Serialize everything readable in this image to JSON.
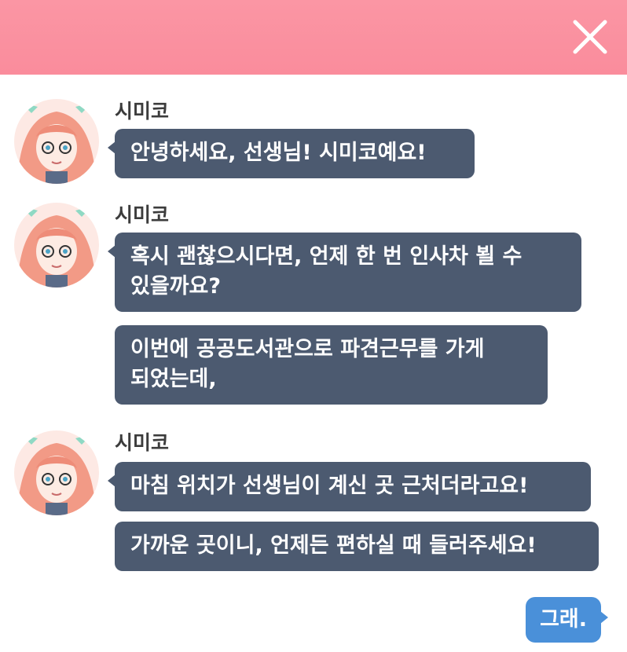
{
  "header": {
    "background": "#fa8c9c",
    "close_icon": "close-icon"
  },
  "messages": [
    {
      "sender": "시미코",
      "bubbles": [
        {
          "lines": [
            "안녕하세요, 선생님! 시미코예요!"
          ]
        }
      ]
    },
    {
      "sender": "시미코",
      "bubbles": [
        {
          "lines": [
            "혹시 괜찮으시다면, 언제 한 번 인사차 뵐 수",
            "있을까요?"
          ]
        },
        {
          "lines": [
            "이번에 공공도서관으로 파견근무를 가게",
            "되었는데,"
          ]
        }
      ]
    },
    {
      "sender": "시미코",
      "bubbles": [
        {
          "lines": [
            "마침 위치가 선생님이 계신 곳 근처더라고요!"
          ]
        },
        {
          "lines": [
            "가까운 곳이니, 언제든 편하실 때 들러주세요!"
          ]
        }
      ]
    }
  ],
  "reply": {
    "label": "그래."
  },
  "colors": {
    "bubble": "#4c5a70",
    "reply": "#4a90d9",
    "avatar_hair": "#f29a86",
    "avatar_ribbon": "#8fd9c4"
  }
}
